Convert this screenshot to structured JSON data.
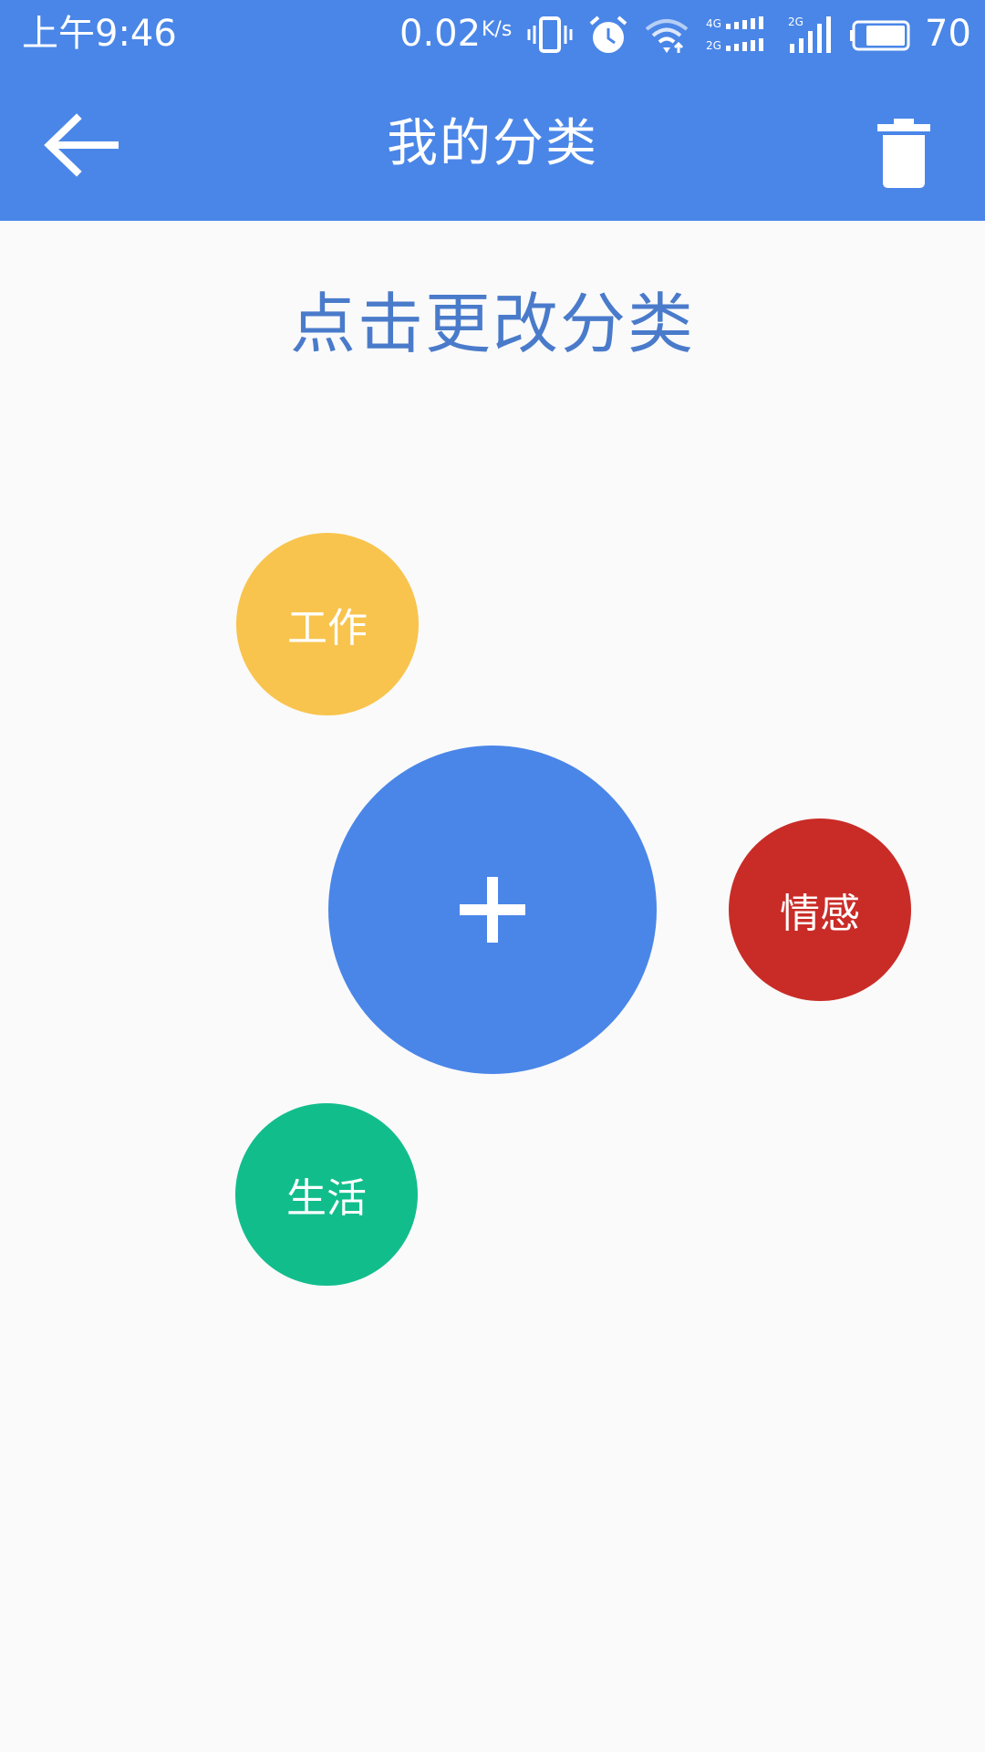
{
  "status_bar": {
    "time": "上午9:46",
    "network_speed": "0.02",
    "network_speed_unit": "K/s",
    "battery_level": "70",
    "icons": [
      "vibrate-icon",
      "alarm-icon",
      "wifi-icon",
      "signal-4g-icon",
      "signal-2g-icon",
      "battery-icon"
    ]
  },
  "app_bar": {
    "title": "我的分类",
    "back_icon": "arrow-left-icon",
    "delete_icon": "trash-icon"
  },
  "content": {
    "hint": "点击更改分类",
    "categories": [
      {
        "label": "工作",
        "color": "#f8c44e"
      },
      {
        "label": "情感",
        "color": "#c92c27"
      },
      {
        "label": "生活",
        "color": "#12bd8c"
      }
    ],
    "add_button": {
      "icon": "plus-icon",
      "color": "#4a86e8"
    }
  },
  "colors": {
    "primary": "#4a86e8",
    "hint_text": "#4a7bcb",
    "background": "#fafafa"
  }
}
